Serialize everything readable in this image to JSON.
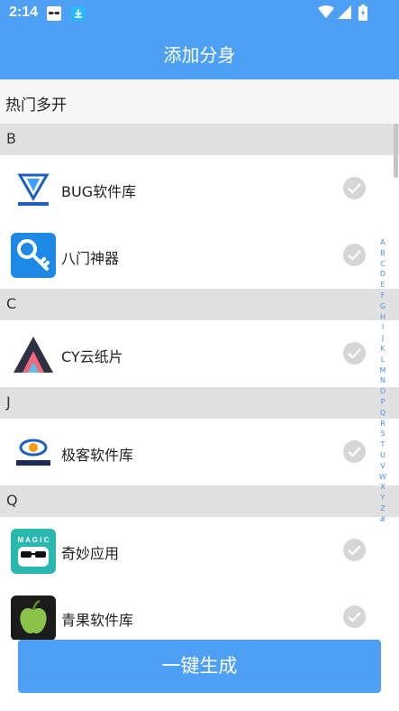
{
  "status_bar": {
    "time": "2:14",
    "icons": [
      "sunglasses-notification-icon",
      "download-notification-icon",
      "wifi-icon",
      "signal-icon",
      "battery-charging-icon"
    ]
  },
  "header": {
    "title": "添加分身"
  },
  "hot_section": {
    "label": "热门多开"
  },
  "sections": [
    {
      "letter": "B",
      "apps": [
        {
          "name": "BUG软件库",
          "icon": "bug-logo-icon",
          "selected": false
        },
        {
          "name": "八门神器",
          "icon": "key-wrench-icon",
          "selected": false
        }
      ]
    },
    {
      "letter": "C",
      "apps": [
        {
          "name": "CY云纸片",
          "icon": "cy-triangle-icon",
          "selected": false
        }
      ]
    },
    {
      "letter": "J",
      "apps": [
        {
          "name": "极客软件库",
          "icon": "geek-logo-icon",
          "selected": false
        }
      ]
    },
    {
      "letter": "Q",
      "apps": [
        {
          "name": "奇妙应用",
          "icon": "magic-sunglasses-icon",
          "selected": false
        },
        {
          "name": "青果软件库",
          "icon": "green-apple-icon",
          "selected": false
        }
      ]
    }
  ],
  "alpha_index": [
    "A",
    "B",
    "C",
    "D",
    "E",
    "F",
    "G",
    "H",
    "I",
    "J",
    "K",
    "L",
    "M",
    "N",
    "O",
    "P",
    "Q",
    "R",
    "S",
    "T",
    "U",
    "V",
    "W",
    "X",
    "Y",
    "Z",
    "#"
  ],
  "footer": {
    "button_label": "一键生成"
  },
  "colors": {
    "primary": "#4da0f5",
    "section_header": "#e1e1e1",
    "check_gray": "#d6d6d6",
    "index_blue": "#4a90e2"
  }
}
